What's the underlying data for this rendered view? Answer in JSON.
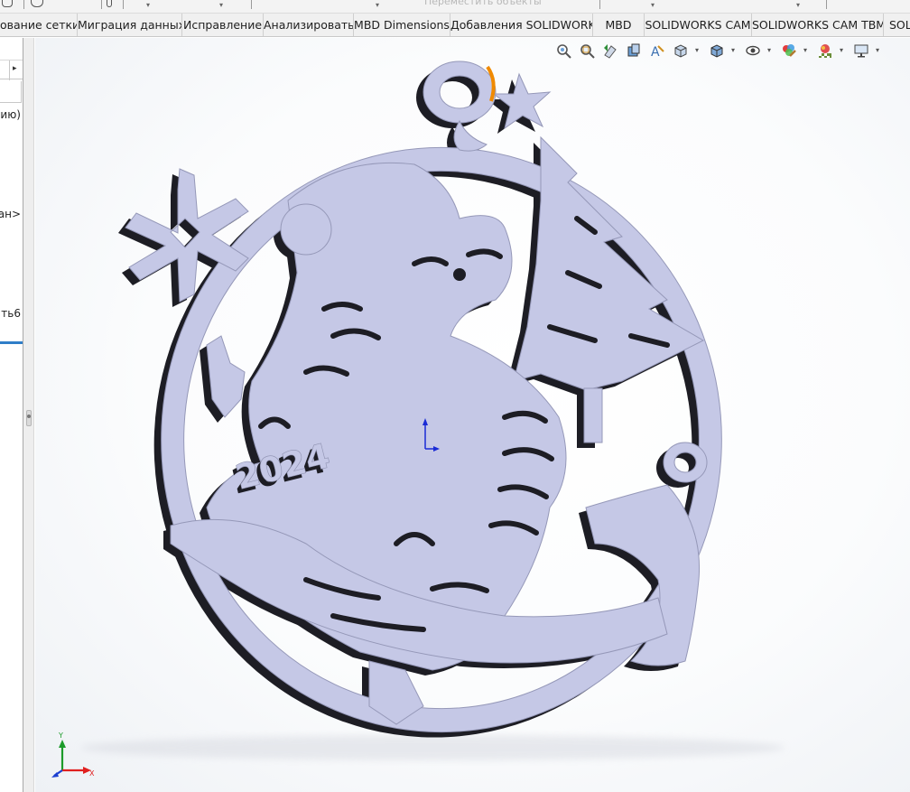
{
  "command_tabs": [
    {
      "label": "ование сетки",
      "w": 86,
      "cls": "partial"
    },
    {
      "label": "Миграция данных",
      "w": 116
    },
    {
      "label": "Исправление",
      "w": 90
    },
    {
      "label": "Анализировать",
      "w": 100
    },
    {
      "label": "MBD Dimensions",
      "w": 107
    },
    {
      "label": "Добавления SOLIDWORKS",
      "w": 158
    },
    {
      "label": "MBD",
      "w": 57
    },
    {
      "label": "SOLIDWORKS CAM",
      "w": 119
    },
    {
      "label": "SOLIDWORKS CAM TBM",
      "w": 146
    },
    {
      "label": "SOL",
      "w": 29,
      "cls": "partial-right"
    }
  ],
  "top_strip": {
    "move_objects_label": "Переместить объекты"
  },
  "left_panel": {
    "lines": [
      "ию)",
      "зан>",
      "ть6"
    ]
  },
  "heads_up_toolbar": [
    {
      "name": "zoom-to-fit-icon"
    },
    {
      "name": "zoom-to-area-icon"
    },
    {
      "name": "previous-view-icon"
    },
    {
      "name": "section-view-icon"
    },
    {
      "name": "dynamic-annotation-views-icon"
    },
    {
      "name": "view-orientation-icon",
      "dropdown": true
    },
    {
      "name": "display-style-icon",
      "dropdown": true
    },
    {
      "name": "hide-show-items-icon",
      "dropdown": true
    },
    {
      "name": "edit-appearance-icon",
      "dropdown": true
    },
    {
      "name": "apply-scene-icon",
      "dropdown": true
    },
    {
      "name": "view-settings-icon",
      "dropdown": true
    }
  ],
  "model": {
    "year_text": "2024"
  },
  "triad": {
    "x_label": "X",
    "y_label": "Y"
  },
  "colors": {
    "part_face": "#c5c8e6",
    "part_shadow": "#1d1d24",
    "selected_edge": "#f08a00",
    "origin": "#1a2bd6",
    "triad_x": "#e0201f",
    "triad_y": "#1c9b2a",
    "triad_z": "#1c3fd0"
  }
}
